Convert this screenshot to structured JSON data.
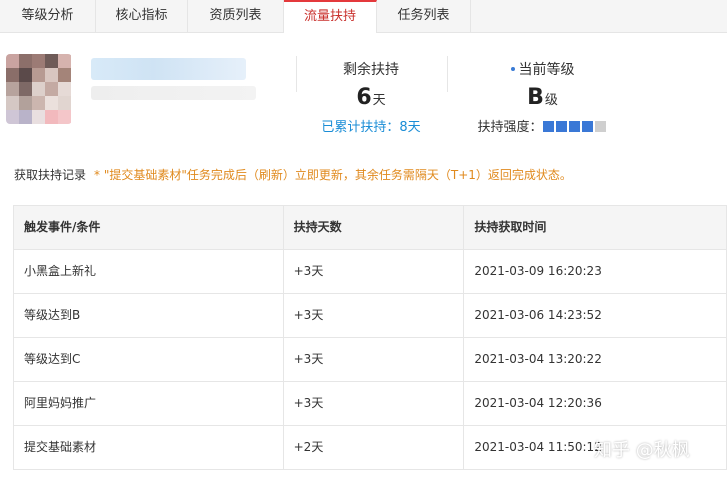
{
  "tabs": [
    {
      "label": "等级分析"
    },
    {
      "label": "核心指标"
    },
    {
      "label": "资质列表"
    },
    {
      "label": "流量扶持"
    },
    {
      "label": "任务列表"
    }
  ],
  "active_tab": "流量扶持",
  "stats": {
    "remaining": {
      "title": "剩余扶持",
      "value": "6",
      "unit": "天",
      "sub": "已累计扶持：8天"
    },
    "level": {
      "title": "当前等级",
      "value": "B",
      "unit": "级",
      "strength_label": "扶持强度：",
      "strength_level": 4,
      "strength_max": 5
    }
  },
  "record": {
    "title": "获取扶持记录",
    "note": "* \"提交基础素材\"任务完成后（刷新）立即更新，其余任务需隔天（T+1）返回完成状态。"
  },
  "table": {
    "headers": [
      "触发事件/条件",
      "扶持天数",
      "扶持获取时间"
    ],
    "rows": [
      [
        "小黑盒上新礼",
        "+3天",
        "2021-03-09 16:20:23"
      ],
      [
        "等级达到B",
        "+3天",
        "2021-03-06 14:23:52"
      ],
      [
        "等级达到C",
        "+3天",
        "2021-03-04 13:20:22"
      ],
      [
        "阿里妈妈推广",
        "+3天",
        "2021-03-04 12:20:36"
      ],
      [
        "提交基础素材",
        "+2天",
        "2021-03-04 11:50:12"
      ]
    ]
  },
  "watermark": "知乎 @秋枫",
  "colors": {
    "active_tab": "#c9302c",
    "link_blue": "#1a8dd6",
    "note_orange": "#e08a1e",
    "strength_on": "#3a78d6",
    "strength_off": "#cfcfcf"
  }
}
